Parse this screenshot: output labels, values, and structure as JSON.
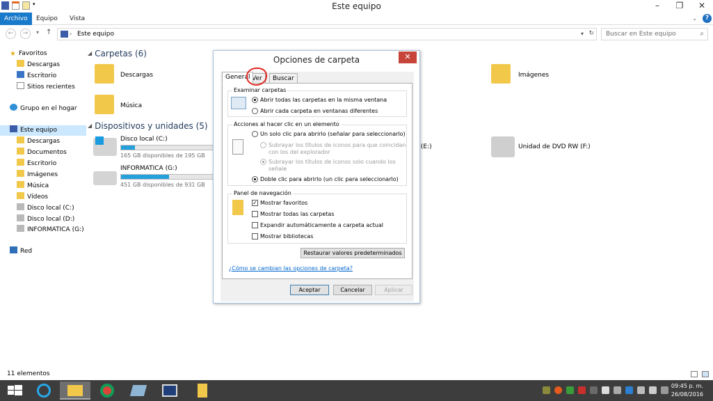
{
  "window": {
    "title": "Este equipo"
  },
  "ribbon": {
    "tabs": [
      "Archivo",
      "Equipo",
      "Vista"
    ]
  },
  "address": {
    "path": "Este equipo",
    "search_placeholder": "Buscar en Este equipo"
  },
  "nav": {
    "favorites": "Favoritos",
    "favorites_items": [
      "Descargas",
      "Escritorio",
      "Sitios recientes"
    ],
    "homegroup": "Grupo en el hogar",
    "thispc": "Este equipo",
    "thispc_items": [
      "Descargas",
      "Documentos",
      "Escritorio",
      "Imágenes",
      "Música",
      "Vídeos",
      "Disco local (C:)",
      "Disco local (D:)",
      "INFORMATICA (G:)"
    ],
    "network": "Red"
  },
  "content": {
    "folders_header": "Carpetas (6)",
    "folders": [
      "Descargas",
      "Música",
      "Imágenes"
    ],
    "devices_header": "Dispositivos y unidades (5)",
    "drives": [
      {
        "name": "Disco local (C:)",
        "free": "165 GB disponibles de 195 GB",
        "used_fraction": 0.15
      },
      {
        "name": "INFORMATICA (G:)",
        "free": "451 GB disponibles de 931 GB",
        "used_fraction": 0.52
      }
    ],
    "partial_drive": "le (E:)",
    "dvd": "Unidad de DVD RW (F:)"
  },
  "status": {
    "items": "11 elementos"
  },
  "taskbar": {
    "time": "09:45 p. m.",
    "date": "26/08/2016"
  },
  "dialog": {
    "title": "Opciones de carpeta",
    "close": "✕",
    "tabs": [
      "General",
      "Ver",
      "Buscar"
    ],
    "browse_group": "Examinar carpetas",
    "browse_opts": [
      "Abrir todas las carpetas en la misma ventana",
      "Abrir cada carpeta en ventanas diferentes"
    ],
    "click_group": "Acciones al hacer clic en un elemento",
    "click_opt1": "Un solo clic para abrirlo (señalar para seleccionarlo)",
    "sub1_line1": "Subrayar los títulos de iconos para que coincidan",
    "sub1_line2": "con los del explorador",
    "sub2_line1": "Subrayar los títulos de iconos solo cuando los",
    "sub2_line2": "señale",
    "click_opt2": "Doble clic para abrirlo (un clic para seleccionarlo)",
    "nav_group": "Panel de navegación",
    "nav_opts": [
      "Mostrar favoritos",
      "Mostrar todas las carpetas",
      "Expandir automáticamente a carpeta actual",
      "Mostrar bibliotecas"
    ],
    "restore": "Restaurar valores predeterminados",
    "help_link": "¿Cómo se cambian las opciones de carpeta?",
    "ok": "Aceptar",
    "cancel": "Cancelar",
    "apply": "Aplicar"
  }
}
